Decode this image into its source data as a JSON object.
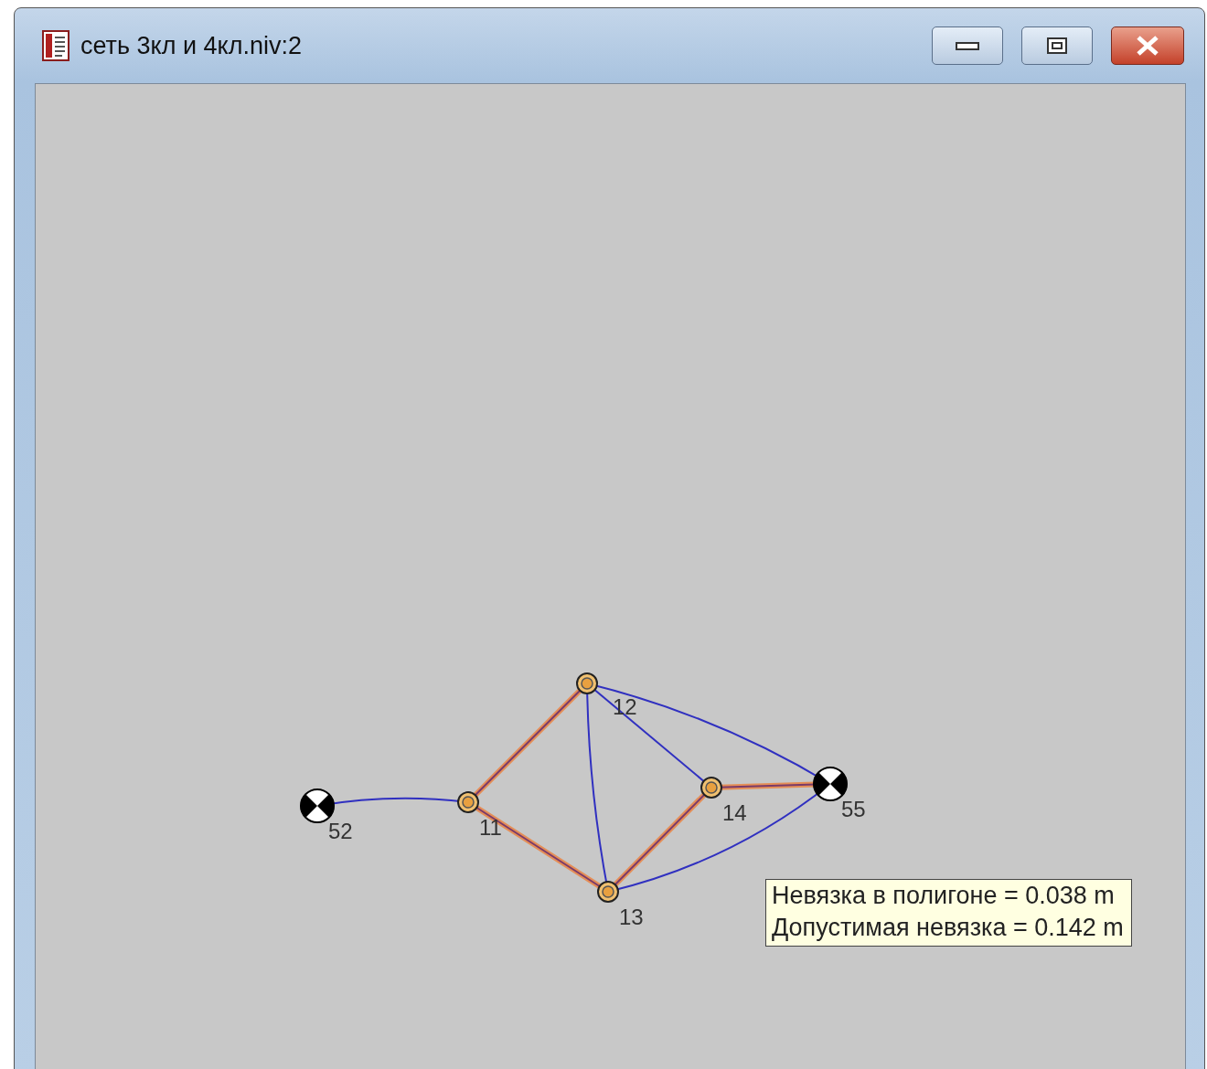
{
  "window": {
    "title": "сеть 3кл и 4кл.niv:2"
  },
  "network": {
    "points": [
      {
        "name": "52",
        "kind": "control"
      },
      {
        "name": "11",
        "kind": "station"
      },
      {
        "name": "12",
        "kind": "station"
      },
      {
        "name": "13",
        "kind": "station"
      },
      {
        "name": "14",
        "kind": "station"
      },
      {
        "name": "55",
        "kind": "control"
      }
    ],
    "legs": [
      {
        "highlighted": false
      },
      {
        "highlighted": true
      },
      {
        "highlighted": true
      },
      {
        "highlighted": false
      },
      {
        "highlighted": false
      },
      {
        "highlighted": false
      },
      {
        "highlighted": false
      },
      {
        "highlighted": true
      },
      {
        "highlighted": true
      }
    ]
  },
  "tooltip": {
    "lines": [
      "Невязка в полигоне = 0.038 m",
      "Допустимая невязка = 0.142 m"
    ]
  }
}
